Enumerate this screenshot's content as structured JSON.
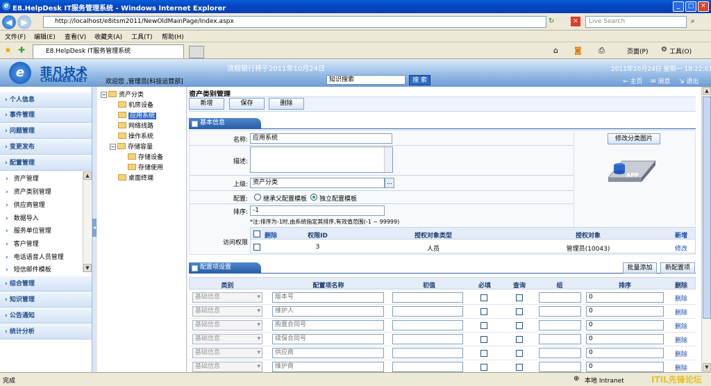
{
  "window": {
    "title": "E8.HelpDesk IT服务管理系统 - Windows Internet Explorer"
  },
  "address": {
    "url": "http://localhost/e8itsm2011/NewOldMainPage/Index.aspx",
    "search_placeholder": "Live Search"
  },
  "menu": [
    "文件(F)",
    "编辑(E)",
    "查看(V)",
    "收藏夹(A)",
    "工具(T)",
    "帮助(H)"
  ],
  "tab": {
    "label": "E8.HelpDesk IT服务管理系统"
  },
  "ie_tools": {
    "page": "页面(P)",
    "tools": "工具(O)"
  },
  "header": {
    "logo_cn": "菲凡技术",
    "logo_en": "CHINAE8.NET",
    "welcome": "欢迎您 ,管理员[科技运营部]",
    "notice": "流程银行将于2011年10月24日",
    "search_value": "知识搜索",
    "search_button": "搜 索",
    "datetime": "2011年10月24日 星期一 18:22:01",
    "home": "主页",
    "message": "消息",
    "logout": "退出"
  },
  "nav": {
    "categories": [
      "个人信息",
      "事件管理",
      "问题管理",
      "变更发布",
      "配置管理"
    ],
    "sub_items": [
      "资产管理",
      "资产类别管理",
      "供应商管理",
      "数据导入",
      "服务单位管理",
      "客户管理",
      "电话语音人员管理",
      "短信邮件模板"
    ],
    "bottom_categories": [
      "综合管理",
      "知识管理",
      "公告通知",
      "统计分析"
    ]
  },
  "tree": {
    "root": "资产分类",
    "nodes": [
      "机房设备",
      "应用系统",
      "网络线路",
      "操作系统",
      "存储容量",
      "存储设备",
      "存储使用",
      "桌面终端"
    ]
  },
  "page": {
    "title": "资产类别管理",
    "buttons": [
      "新增",
      "保存",
      "删除"
    ],
    "basic_section": "基本信息",
    "labels": {
      "name": "名称:",
      "desc": "描述:",
      "parent": "上级:",
      "config": "配置:",
      "order": "排序:",
      "access": "访问权限"
    },
    "values": {
      "name": "应用系统",
      "desc": "",
      "parent": "资产分类",
      "order": "-1"
    },
    "radio": {
      "inherit": "继承父配置模板",
      "independent": "独立配置模板"
    },
    "note": "*注:排序为-1时,由系统指定其排序,有效值范围(-1 ~ 99999)",
    "change_image": "修改分类图片",
    "app_label": "APP",
    "perm_headers": {
      "delete": "删除",
      "id": "权限ID",
      "type": "授权对象类型",
      "target": "授权对象",
      "add": "新增"
    },
    "perm_row": {
      "id": "3",
      "type": "人员",
      "target": "管理员(10043)",
      "edit": "修改"
    },
    "config_section": "配置项设置",
    "config_buttons": [
      "批量添加",
      "新配置项"
    ],
    "grid_headers": [
      "类别",
      "配置项名称",
      "初值",
      "必填",
      "查询",
      "组",
      "排序",
      "删除"
    ],
    "grid_rows": [
      {
        "category": "基础信息",
        "name": "版本号",
        "order": "0",
        "del": "删除"
      },
      {
        "category": "基础信息",
        "name": "维护人",
        "order": "0",
        "del": "删除"
      },
      {
        "category": "基础信息",
        "name": "购置合同号",
        "order": "0",
        "del": "删除"
      },
      {
        "category": "基础信息",
        "name": "续保合同号",
        "order": "0",
        "del": "删除"
      },
      {
        "category": "基础信息",
        "name": "供应商",
        "order": "0",
        "del": "删除"
      },
      {
        "category": "基础信息",
        "name": "维护商",
        "order": "0",
        "del": "删除"
      }
    ]
  },
  "status": {
    "text": "完成",
    "zone": "本地 Intranet",
    "watermark": "ITIL先锋论坛"
  }
}
